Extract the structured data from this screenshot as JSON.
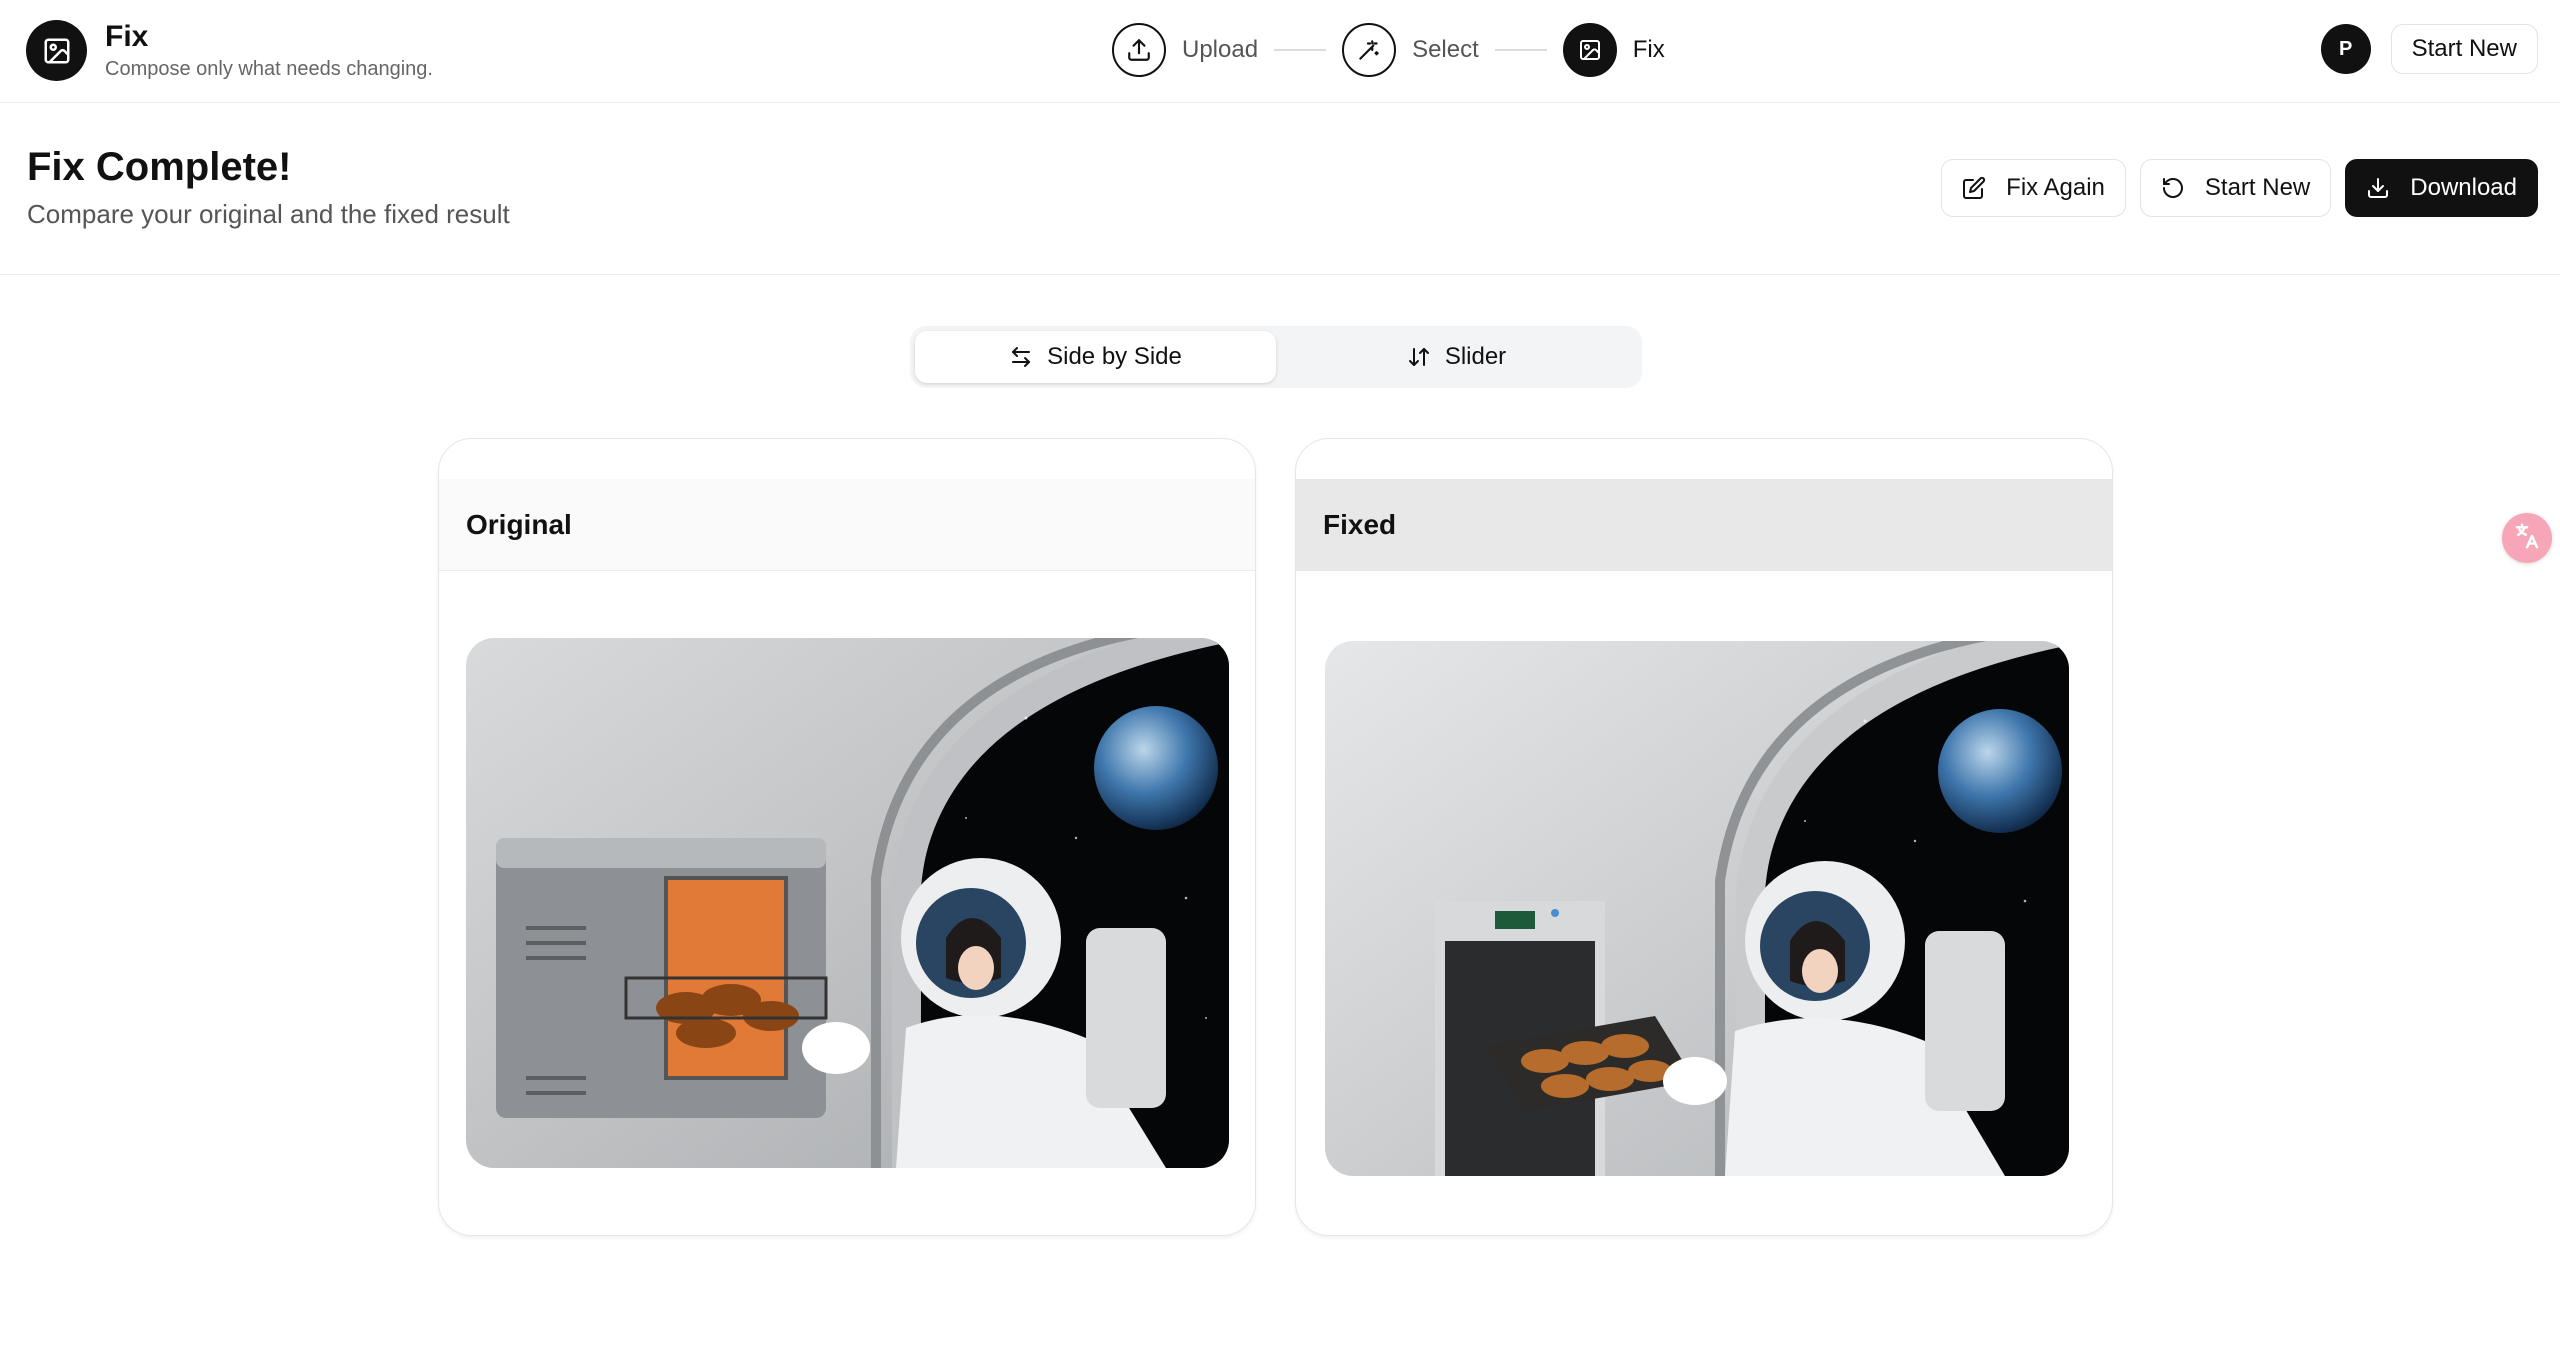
{
  "app": {
    "title": "Fix",
    "subtitle": "Compose only what needs changing."
  },
  "steps": [
    {
      "label": "Upload",
      "icon": "upload-icon"
    },
    {
      "label": "Select",
      "icon": "magic-wand-icon"
    },
    {
      "label": "Fix",
      "icon": "image-icon",
      "active": true
    }
  ],
  "header_right": {
    "avatar_initial": "P",
    "start_new_label": "Start New"
  },
  "page": {
    "title": "Fix Complete!",
    "subtitle": "Compare your original and the fixed result"
  },
  "actions": {
    "fix_again": "Fix Again",
    "start_new": "Start New",
    "download": "Download"
  },
  "view_toggle": {
    "side_by_side": "Side by Side",
    "slider": "Slider",
    "selected": "Side by Side"
  },
  "panels": {
    "original": {
      "label": "Original"
    },
    "fixed": {
      "label": "Fixed"
    }
  },
  "colors": {
    "primary": "#111111",
    "border": "#e6e6e6",
    "fab": "#f7a6b8"
  }
}
